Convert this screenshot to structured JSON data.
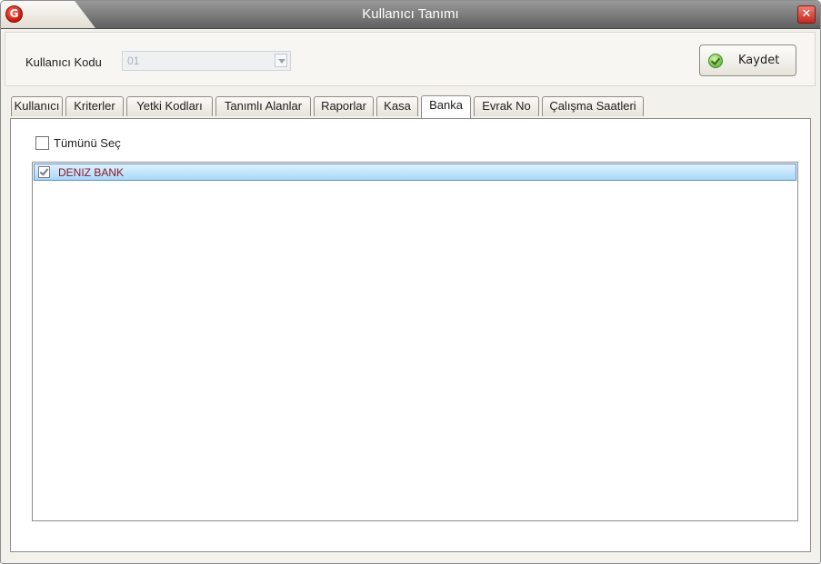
{
  "window": {
    "title": "Kullanıcı Tanımı",
    "logo_glyph": "G",
    "close_glyph": "✕",
    "accent_color": "#d4261a"
  },
  "header": {
    "kod_label": "Kullanıcı Kodu",
    "kod_value": "01",
    "save_label": "Kaydet"
  },
  "tabs": [
    {
      "label": "Kullanıcı",
      "active": false
    },
    {
      "label": "Kriterler",
      "active": false
    },
    {
      "label": "Yetki Kodları",
      "active": false
    },
    {
      "label": "Tanımlı Alanlar",
      "active": false
    },
    {
      "label": "Raporlar",
      "active": false
    },
    {
      "label": "Kasa",
      "active": false
    },
    {
      "label": "Banka",
      "active": true
    },
    {
      "label": "Evrak No",
      "active": false
    },
    {
      "label": "Çalışma Saatleri",
      "active": false
    }
  ],
  "banka": {
    "select_all_label": "Tümünü Seç",
    "select_all_checked": false,
    "items": [
      {
        "label": "DENIZ BANK",
        "checked": true,
        "selected": true
      }
    ]
  }
}
